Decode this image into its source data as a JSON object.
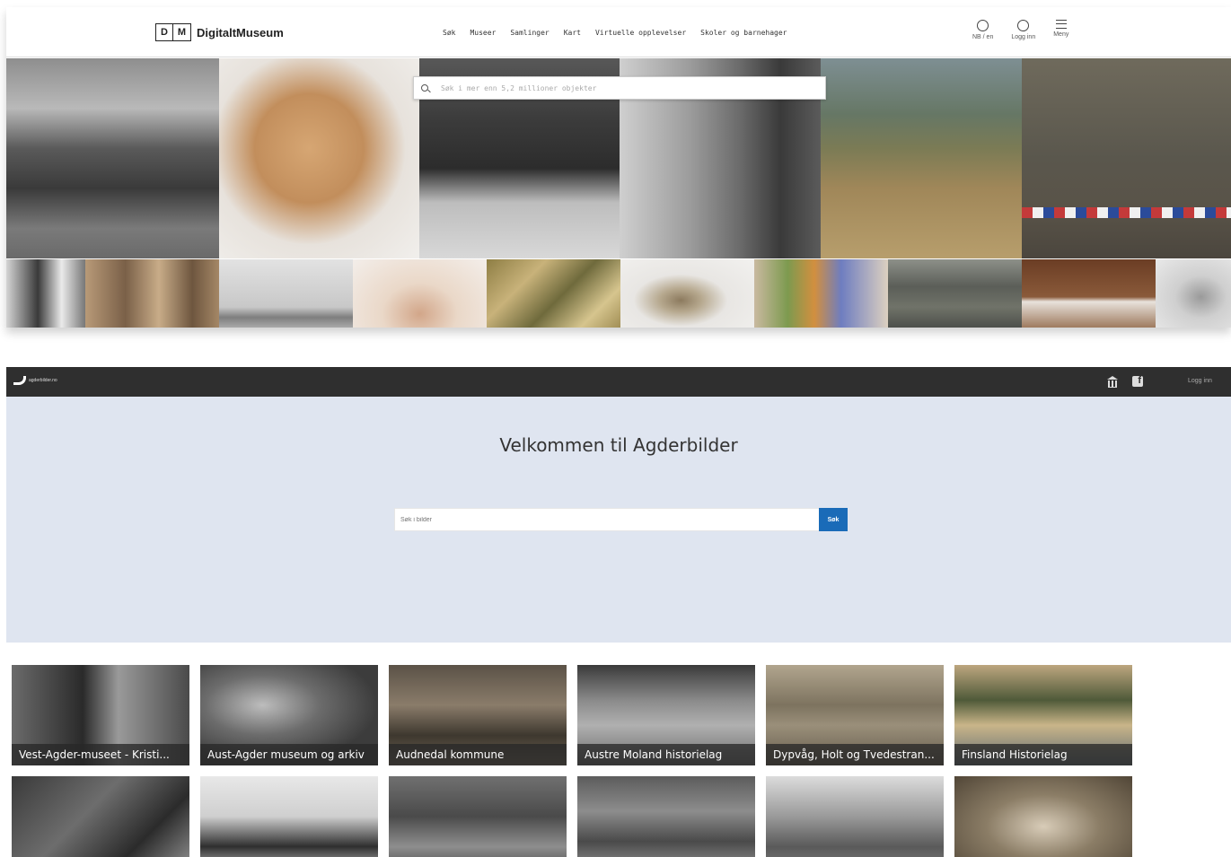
{
  "digitaltmuseum": {
    "logo_letters": [
      "D",
      "M"
    ],
    "logo_text": "DigitaltMuseum",
    "nav": [
      "Søk",
      "Museer",
      "Samlinger",
      "Kart",
      "Virtuelle opplevelser",
      "Skoler og barnehager"
    ],
    "right_icons": [
      {
        "icon": "globe-icon",
        "label": "NB / en"
      },
      {
        "icon": "user-icon",
        "label": "Logg inn"
      },
      {
        "icon": "menu-icon",
        "label": "Meny"
      }
    ],
    "search_placeholder": "Søk i mer enn 5,2 millioner objekter"
  },
  "agderbilder": {
    "logo_text": "agderbilder.no",
    "login_label": "Logg inn",
    "title": "Velkommen til Agderbilder",
    "search_placeholder": "Søk i bilder",
    "search_button": "Søk",
    "cards": [
      "Vest-Agder-museet - Kristi...",
      "Aust-Agder museum og arkiv",
      "Audnedal kommune",
      "Austre Moland historielag",
      "Dypvåg, Holt og Tvedestran...",
      "Finsland Historielag"
    ]
  },
  "colors": {
    "agder_bar": "#2f2f2f",
    "agder_hero": "#dfe5f0",
    "agder_button": "#1a6bb8"
  }
}
